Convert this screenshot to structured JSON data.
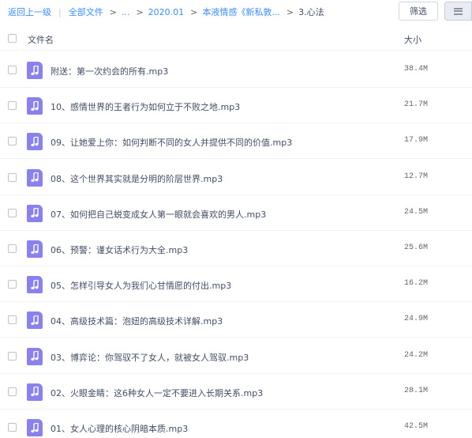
{
  "breadcrumb": {
    "back_label": "返回上一级",
    "separator": "|",
    "root_label": "全部文件",
    "ellipsis_label": "...",
    "arrow": ">",
    "crumb_1": "2020.01",
    "crumb_2": "本液情感《新私敦...",
    "current": "3.心法"
  },
  "toolbar": {
    "filter_label": "筛选",
    "view_icon": "list-view-icon"
  },
  "table": {
    "col_name": "文件名",
    "col_size": "大小"
  },
  "files": [
    {
      "name": "附送：第一次约会的所有.mp3",
      "size": "38.4M",
      "icon": "audio-file-icon"
    },
    {
      "name": "10、感情世界的王者行为如何立于不败之地.mp3",
      "size": "21.7M",
      "icon": "audio-file-icon"
    },
    {
      "name": "09、让她爱上你：如何判断不同的女人并提供不同的价值.mp3",
      "size": "17.9M",
      "icon": "audio-file-icon"
    },
    {
      "name": "08、这个世界其实就是分明的阶层世界.mp3",
      "size": "12.7M",
      "icon": "audio-file-icon"
    },
    {
      "name": "07、如何把自己蜕变成女人第一眼就会喜欢的男人.mp3",
      "size": "24.5M",
      "icon": "audio-file-icon"
    },
    {
      "name": "06、预警：谨女话术行为大全.mp3",
      "size": "25.6M",
      "icon": "audio-file-icon"
    },
    {
      "name": "05、怎样引导女人为我们心甘情愿的付出.mp3",
      "size": "16.2M",
      "icon": "audio-file-icon"
    },
    {
      "name": "04、高级技术篇：泡妞的高级技术详解.mp3",
      "size": "24.9M",
      "icon": "audio-file-icon"
    },
    {
      "name": "03、博弈论：你驾驭不了女人，就被女人驾驭.mp3",
      "size": "24.2M",
      "icon": "audio-file-icon"
    },
    {
      "name": "02、火眼金睛：这6种女人一定不要进入长期关系.mp3",
      "size": "28.1M",
      "icon": "audio-file-icon"
    },
    {
      "name": "01、女人心理的核心阴暗本质.mp3",
      "size": "42.5M",
      "icon": "audio-file-icon"
    }
  ],
  "colors": {
    "link": "#3b8cff",
    "file_icon": "#8a81f0",
    "text": "#424e67"
  }
}
